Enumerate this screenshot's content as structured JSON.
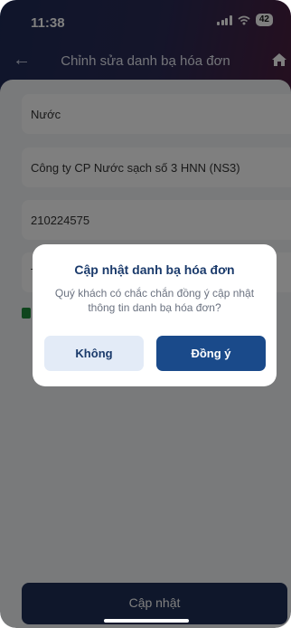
{
  "status_bar": {
    "time": "11:38",
    "battery": "42"
  },
  "nav": {
    "back_icon": "arrow-left-icon",
    "title": "Chỉnh sửa danh bạ hóa đơn",
    "home_icon": "home-icon"
  },
  "form": {
    "service": "Nước",
    "provider": "Công ty CP Nước sạch số 3 HNN (NS3)",
    "customer_code": "210224575",
    "partial_label": "T"
  },
  "footer": {
    "submit_label": "Cập nhật"
  },
  "dialog": {
    "title": "Cập nhật danh bạ hóa đơn",
    "message": "Quý khách có chắc chắn đồng ý cập nhật thông tin danh bạ hóa đơn?",
    "cancel_label": "Không",
    "confirm_label": "Đồng ý"
  },
  "colors": {
    "header_start": "#1f2b57",
    "header_end": "#4a1f3f",
    "primary": "#1a4a8a",
    "submit": "#1e2f57",
    "title": "#1a3a6b"
  }
}
